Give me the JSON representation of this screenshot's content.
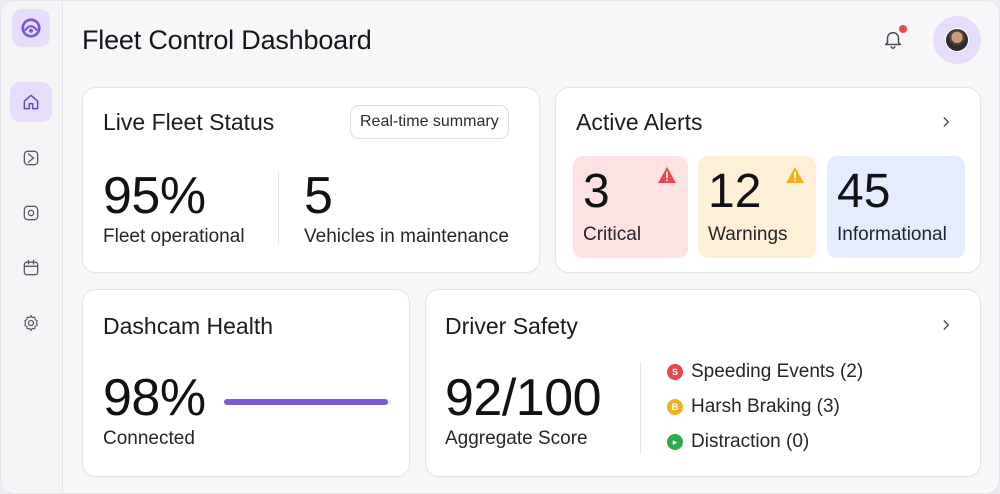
{
  "header": {
    "title": "Fleet Control Dashboard"
  },
  "sidebar": {
    "items": [
      {
        "icon": "home-icon",
        "active": true
      },
      {
        "icon": "route-icon",
        "active": false
      },
      {
        "icon": "dashcam-icon",
        "active": false
      },
      {
        "icon": "calendar-icon",
        "active": false
      },
      {
        "icon": "gear-icon",
        "active": false
      }
    ]
  },
  "colors": {
    "accent": "#7e58d4",
    "accent_soft": "#e6ddfa",
    "critical_bg": "#fde2e4",
    "warning_bg": "#fdf0d6",
    "info_bg": "#e4ecfd",
    "red": "#e5484d",
    "amber": "#f2b01e",
    "green": "#2fa84f"
  },
  "fleet_status": {
    "title": "Live Fleet Status",
    "pill_label": "Real-time summary",
    "stat1": {
      "value": "95%",
      "label": "Fleet operational"
    },
    "stat2": {
      "value": "5",
      "label": "Vehicles in maintenance"
    }
  },
  "alerts": {
    "title": "Active Alerts",
    "critical": {
      "value": "3",
      "label": "Critical"
    },
    "warnings": {
      "value": "12",
      "label": "Warnings"
    },
    "informational": {
      "value": "45",
      "label": "Informational"
    }
  },
  "dashcam": {
    "title": "Dashcam Health",
    "value": "98%",
    "label": "Connected",
    "connected_fraction": 0.98
  },
  "driver_safety": {
    "title": "Driver Safety",
    "score": "92/100",
    "score_label": "Aggregate Score",
    "events": [
      {
        "label": "Speeding Events (2)",
        "glyph": "S",
        "color": "#e5484d"
      },
      {
        "label": "Harsh Braking (3)",
        "glyph": "B",
        "color": "#f2b01e"
      },
      {
        "label": "Distraction (0)",
        "glyph": "▸",
        "color": "#2fa84f"
      }
    ]
  }
}
